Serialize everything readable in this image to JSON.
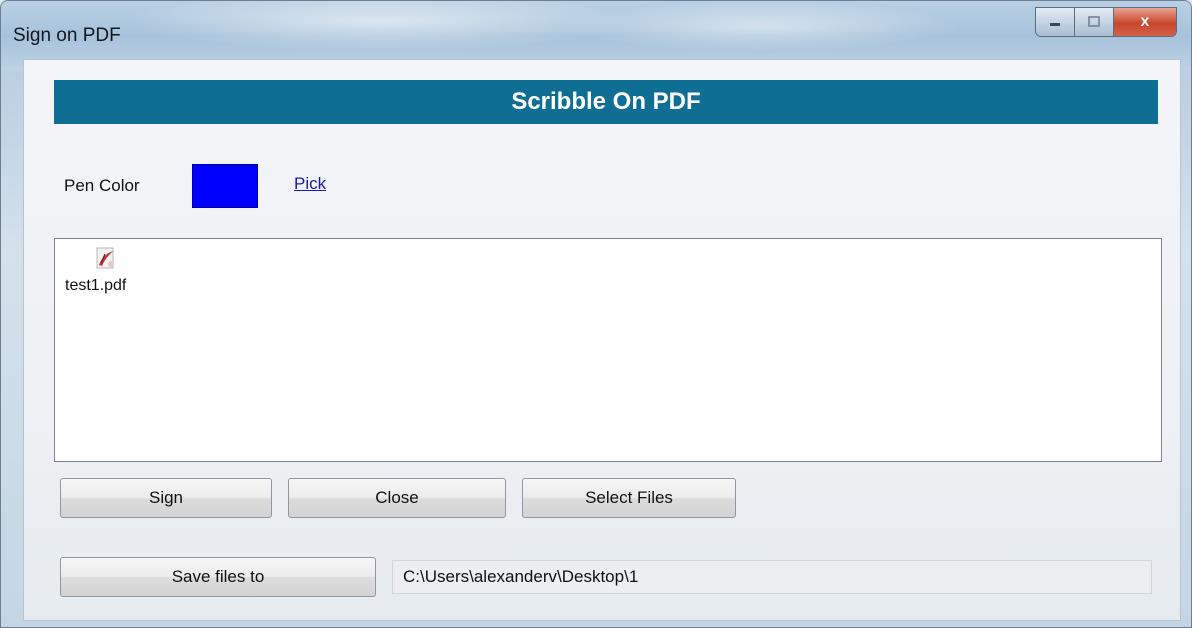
{
  "window": {
    "title": "Sign on PDF",
    "minimize_label": "",
    "maximize_label": "",
    "close_label": "x"
  },
  "banner": {
    "text": "Scribble On PDF"
  },
  "pen": {
    "label": "Pen Color",
    "color": "#0000ff",
    "pick_label": "Pick"
  },
  "files": [
    {
      "name": "test1.pdf",
      "icon": "pdf-file-icon"
    }
  ],
  "buttons": {
    "sign": "Sign",
    "close": "Close",
    "select_files": "Select Files",
    "save_files_to": "Save files to"
  },
  "save_path": "C:\\Users\\alexanderv\\Desktop\\1",
  "colors": {
    "banner": "#0f6e93",
    "link": "#1a1aa8"
  }
}
